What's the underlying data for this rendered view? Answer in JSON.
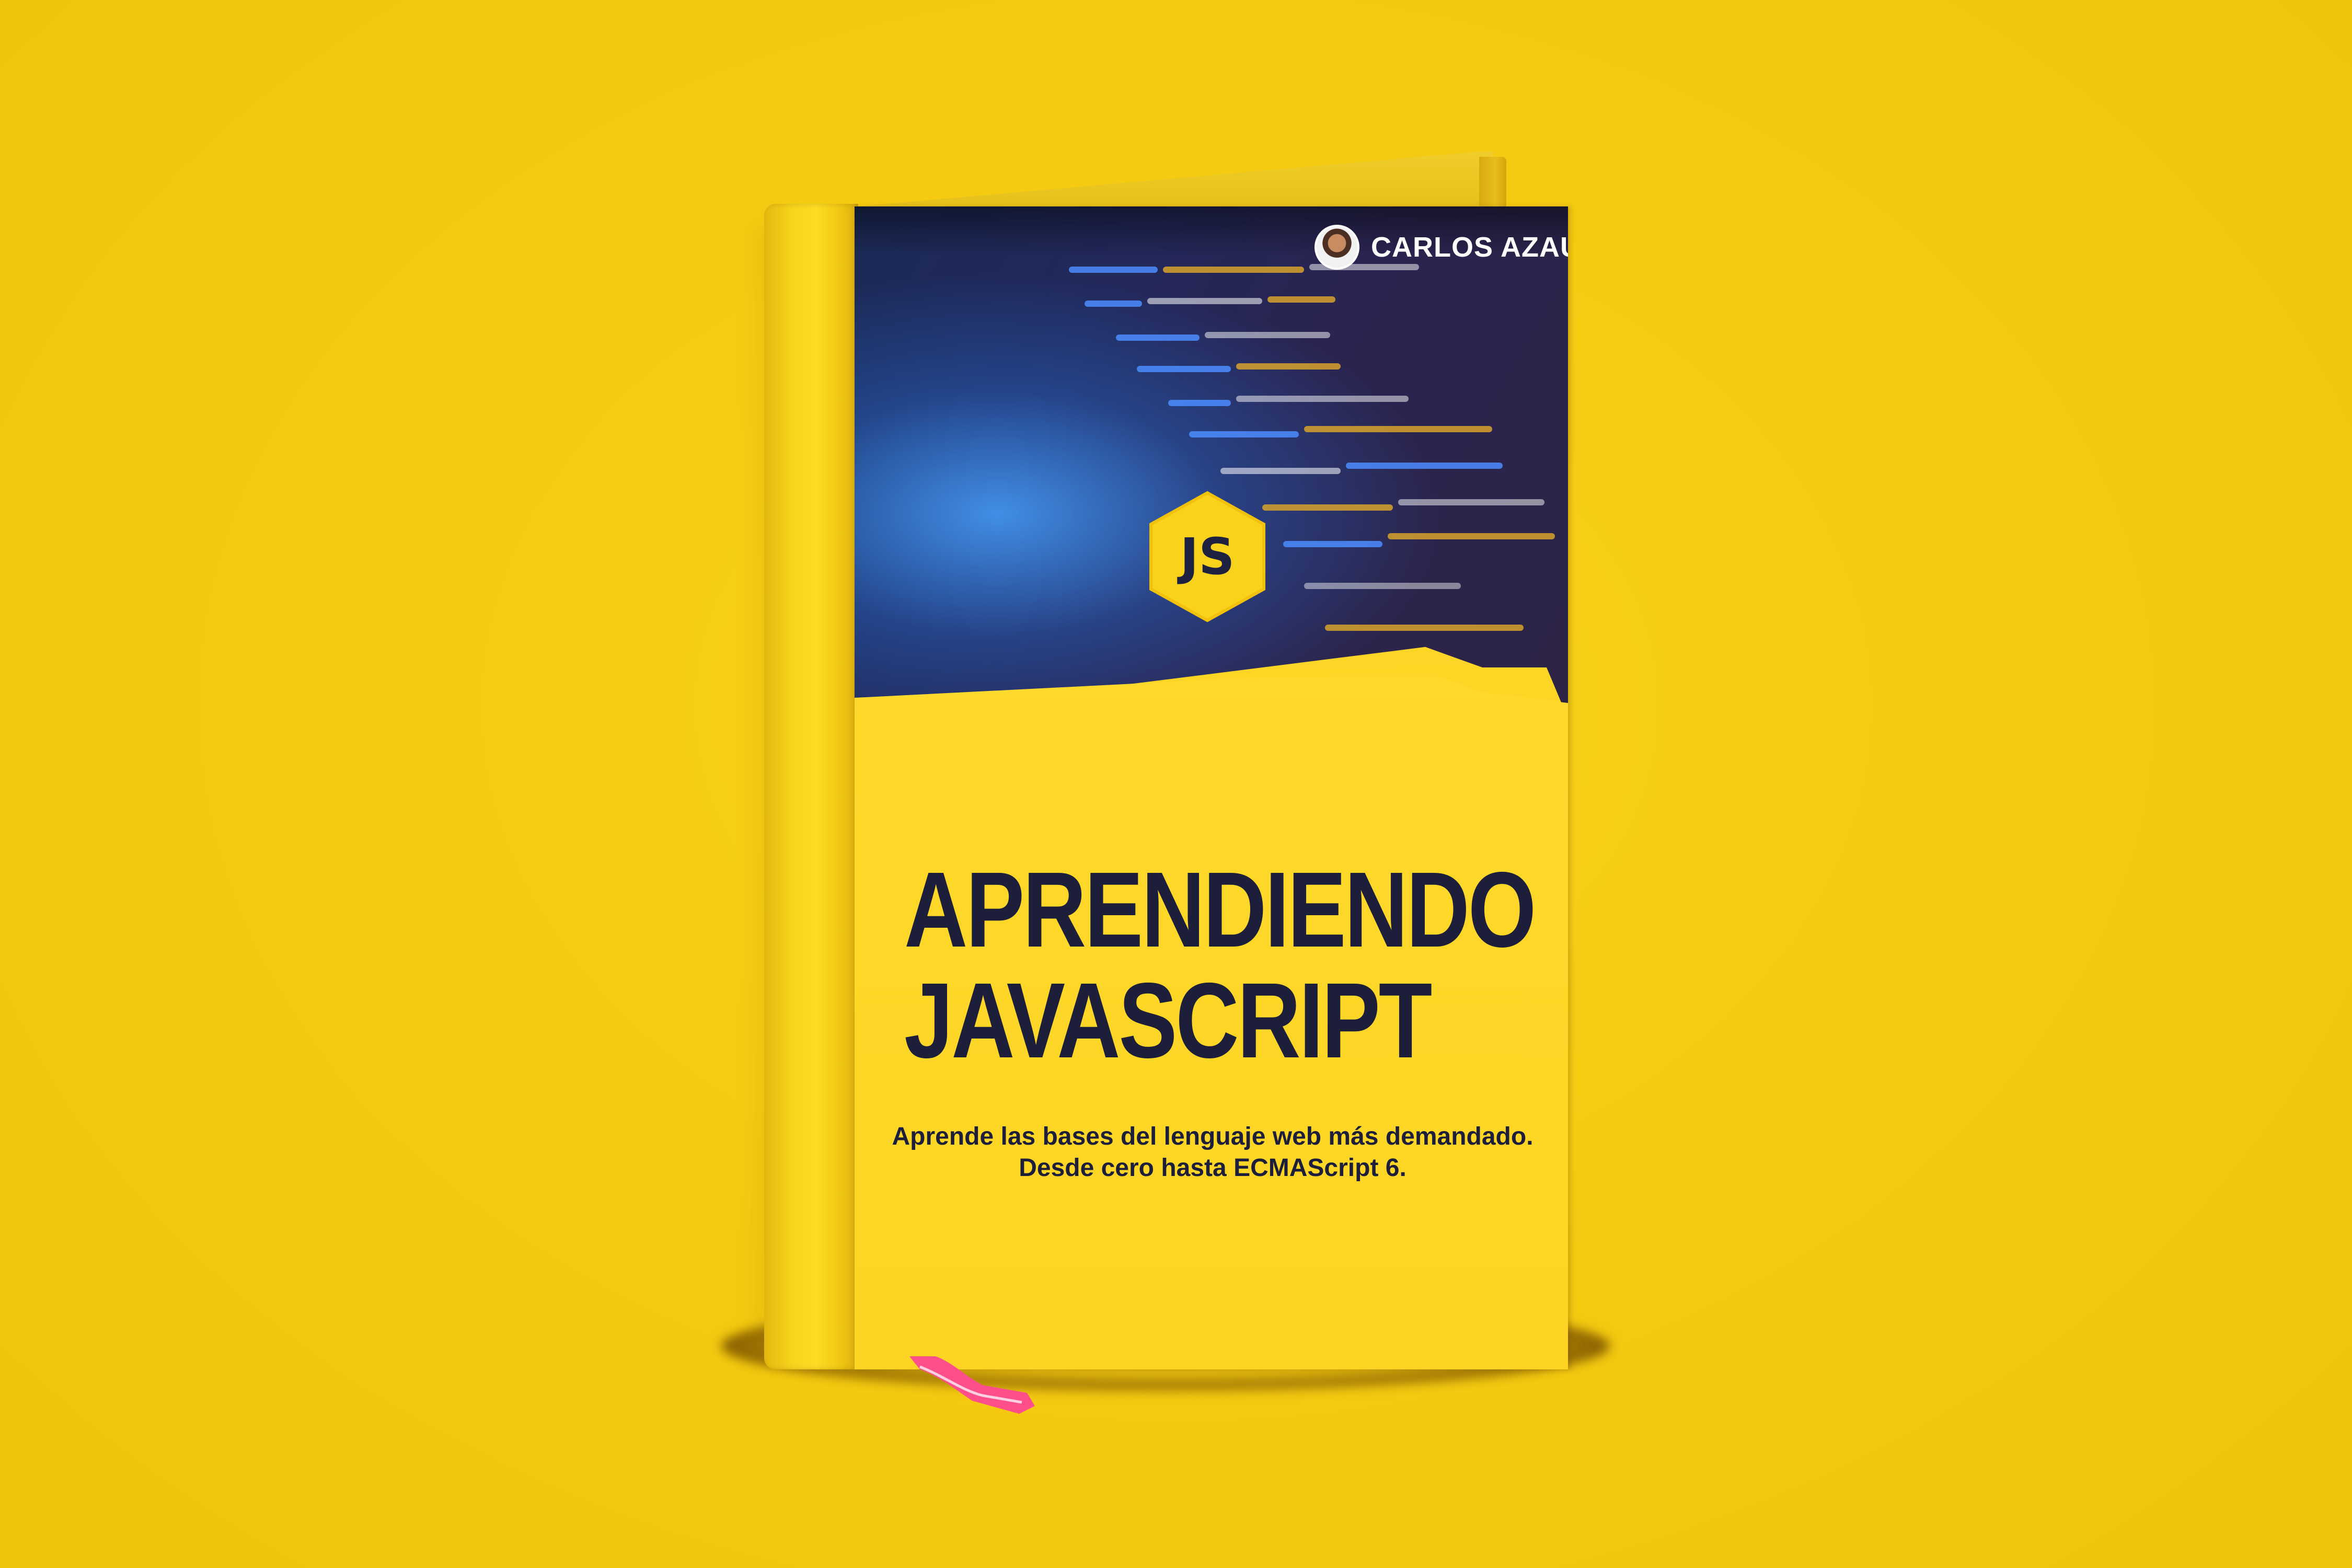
{
  "book": {
    "author": "CARLOS AZAUSTR",
    "badge": "JS",
    "title_lines": [
      "APRENDIENDO",
      "JAVASCRIPT"
    ],
    "subtitle_lines": [
      "Aprende las bases del lenguaje web más demandado.",
      "Desde cero hasta ECMAScript 6."
    ]
  },
  "colors": {
    "background": "#f5cb12",
    "cover_yellow": "#fdd523",
    "title_navy": "#1d1f3a",
    "code_dark": "#22285a",
    "ribbon_pink": "#ff4f8b"
  }
}
